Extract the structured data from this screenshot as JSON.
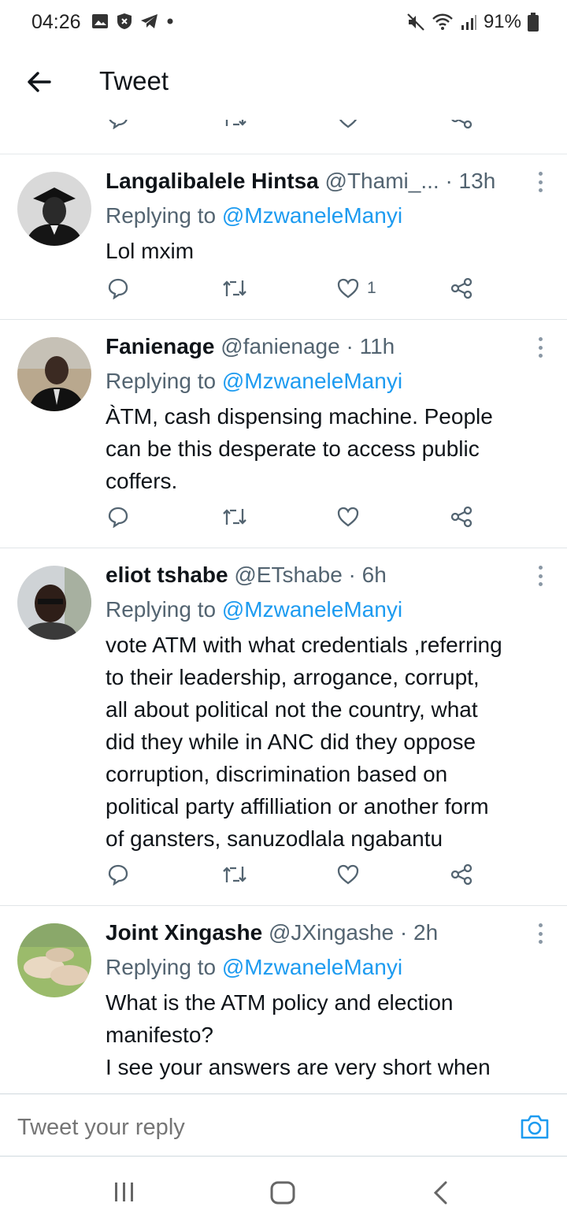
{
  "status_bar": {
    "time": "04:26",
    "battery": "91%"
  },
  "header": {
    "title": "Tweet"
  },
  "tweets": [
    {
      "name": "Langalibalele Hintsa",
      "handle": "@Thami_...",
      "time": "· 13h",
      "replying_prefix": "Replying to",
      "replying_to": "@MzwaneleManyi",
      "text_lines": [
        "Lol mxim"
      ],
      "like_count": "1"
    },
    {
      "name": "Fanienage",
      "handle": "@fanienage",
      "time": "· 11h",
      "replying_prefix": "Replying to",
      "replying_to": "@MzwaneleManyi",
      "text_lines": [
        "ÀTM, cash dispensing machine. People",
        "can be this desperate to access public",
        "coffers."
      ],
      "like_count": ""
    },
    {
      "name": "eliot tshabe",
      "handle": "@ETshabe",
      "time": "· 6h",
      "replying_prefix": "Replying to",
      "replying_to": "@MzwaneleManyi",
      "text_lines": [
        "vote ATM with what credentials ,referring",
        "to their leadership, arrogance, corrupt,",
        "all about political not the country, what",
        "did they while in ANC did they oppose",
        "corruption, discrimination based on",
        "political party affilliation or another form",
        "of gansters, sanuzodlala ngabantu"
      ],
      "like_count": ""
    },
    {
      "name": "Joint Xingashe",
      "handle": "@JXingashe",
      "time": "· 2h",
      "replying_prefix": "Replying to",
      "replying_to": "@MzwaneleManyi",
      "text_lines": [
        "What is the ATM policy and election",
        "manifesto?",
        "I see your answers are very short when"
      ],
      "like_count": ""
    }
  ],
  "reply_bar": {
    "placeholder": "Tweet your reply"
  },
  "colors": {
    "accent": "#1d9bf0",
    "muted": "#536471",
    "text": "#0f1419"
  },
  "icons": [
    "back-arrow-icon",
    "reply-icon",
    "retweet-icon",
    "like-icon",
    "share-icon",
    "more-icon",
    "camera-icon",
    "recents-icon",
    "home-icon",
    "back-nav-icon"
  ]
}
